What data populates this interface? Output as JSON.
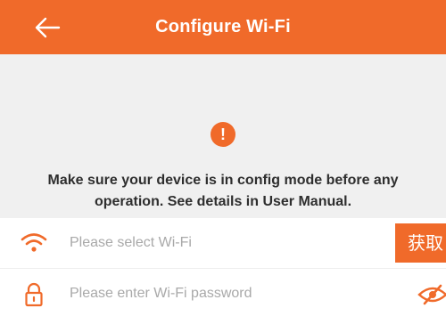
{
  "header": {
    "title": "Configure Wi-Fi",
    "back_icon": "arrow-left-icon",
    "background_color": "#f06a2a"
  },
  "notice": {
    "icon": "exclamation-icon",
    "icon_glyph": "!",
    "text": "Make sure your device is in config mode before any operation. See details in User Manual.",
    "background_color": "#f0f0f0"
  },
  "wifi_row": {
    "icon": "wifi-icon",
    "placeholder": "Please select Wi-Fi",
    "value": "",
    "button_label": "获取"
  },
  "password_row": {
    "icon": "lock-icon",
    "placeholder": "Please enter Wi-Fi password",
    "value": "",
    "visibility_icon": "eye-slash-icon"
  },
  "accent_color": "#f06a2a"
}
